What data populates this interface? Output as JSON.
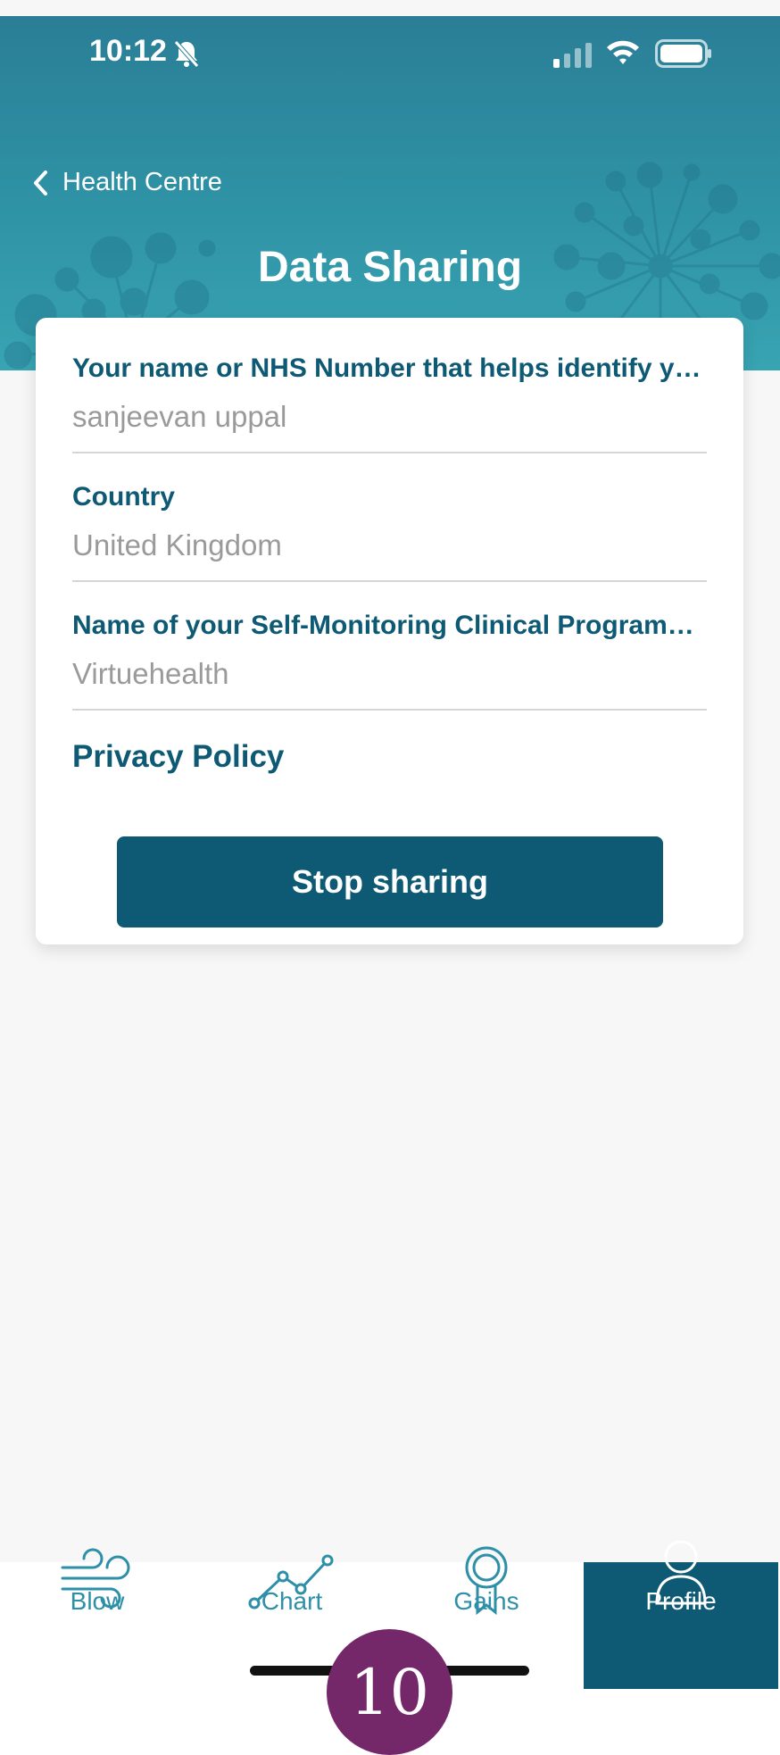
{
  "status_bar": {
    "time": "10:12"
  },
  "header": {
    "back_label": "Health Centre",
    "title": "Data Sharing"
  },
  "form": {
    "fields": [
      {
        "label": "Your name or NHS Number that helps identify y…",
        "value": "sanjeevan uppal"
      },
      {
        "label": "Country",
        "value": "United Kingdom"
      },
      {
        "label": "Name of your Self-Monitoring Clinical Program…",
        "value": "Virtuehealth"
      }
    ],
    "privacy_label": "Privacy Policy",
    "stop_button_label": "Stop sharing"
  },
  "tabbar": {
    "tabs": [
      {
        "label": "Blow",
        "icon": "wind-icon"
      },
      {
        "label": "Chart",
        "icon": "line-chart-icon"
      },
      {
        "label": "Gains",
        "icon": "award-icon"
      },
      {
        "label": "Profile",
        "icon": "user-icon"
      }
    ],
    "active": "Profile"
  },
  "overlay_badge": "10",
  "colors": {
    "primary": "#0e5a74",
    "header": "#2f93a6",
    "badge": "#742769"
  }
}
